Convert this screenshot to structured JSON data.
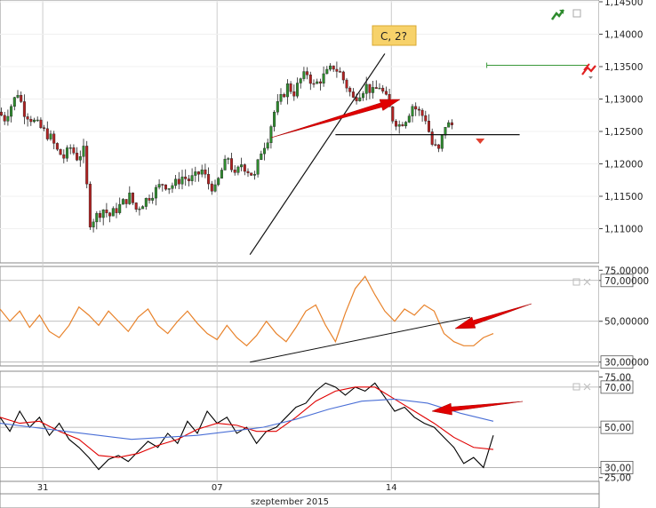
{
  "colors": {
    "up": "#2e8b2e",
    "down": "#b22222",
    "rsi": "#e8822a",
    "stoch_k": "#000000",
    "stoch_d": "#e00000",
    "stoch_slow": "#4a6fd6",
    "arrow": "#e00000",
    "grid": "#cccccc",
    "annotation_bg": "#f7d26a"
  },
  "annotation": {
    "label": "C, 2?"
  },
  "x_axis": {
    "ticks": [
      {
        "label": "31",
        "index": 13
      },
      {
        "label": "07",
        "index": 66
      },
      {
        "label": "14",
        "index": 119
      }
    ],
    "month_label": "szeptember 2015",
    "n_bars": 138
  },
  "chart_data": [
    {
      "type": "candlestick",
      "panel": "price",
      "ylim": [
        1.105,
        1.145
      ],
      "y_ticks": [
        "1,14500",
        "1,14000",
        "1,13500",
        "1,13000",
        "1,12500",
        "1,12000",
        "1,11500",
        "1,11000"
      ],
      "y_tick_values": [
        1.145,
        1.14,
        1.135,
        1.13,
        1.125,
        1.12,
        1.115,
        1.11
      ],
      "close_path": [
        [
          0,
          1.128
        ],
        [
          2,
          1.127
        ],
        [
          4,
          1.129
        ],
        [
          6,
          1.131
        ],
        [
          8,
          1.128
        ],
        [
          10,
          1.127
        ],
        [
          12,
          1.126
        ],
        [
          14,
          1.125
        ],
        [
          16,
          1.124
        ],
        [
          18,
          1.122
        ],
        [
          20,
          1.121
        ],
        [
          22,
          1.1225
        ],
        [
          24,
          1.121
        ],
        [
          26,
          1.122
        ],
        [
          28,
          1.111
        ],
        [
          30,
          1.112
        ],
        [
          32,
          1.113
        ],
        [
          34,
          1.112
        ],
        [
          36,
          1.113
        ],
        [
          38,
          1.114
        ],
        [
          40,
          1.115
        ],
        [
          42,
          1.113
        ],
        [
          44,
          1.114
        ],
        [
          46,
          1.115
        ],
        [
          48,
          1.116
        ],
        [
          50,
          1.117
        ],
        [
          52,
          1.1165
        ],
        [
          54,
          1.117
        ],
        [
          56,
          1.118
        ],
        [
          58,
          1.1175
        ],
        [
          60,
          1.118
        ],
        [
          62,
          1.119
        ],
        [
          64,
          1.117
        ],
        [
          66,
          1.116
        ],
        [
          68,
          1.119
        ],
        [
          70,
          1.121
        ],
        [
          72,
          1.118
        ],
        [
          74,
          1.12
        ],
        [
          76,
          1.119
        ],
        [
          78,
          1.118
        ],
        [
          80,
          1.122
        ],
        [
          82,
          1.124
        ],
        [
          84,
          1.128
        ],
        [
          86,
          1.13
        ],
        [
          88,
          1.132
        ],
        [
          90,
          1.131
        ],
        [
          92,
          1.133
        ],
        [
          94,
          1.134
        ],
        [
          96,
          1.132
        ],
        [
          98,
          1.133
        ],
        [
          100,
          1.134
        ],
        [
          102,
          1.135
        ],
        [
          104,
          1.134
        ],
        [
          106,
          1.132
        ],
        [
          108,
          1.13
        ],
        [
          110,
          1.131
        ],
        [
          112,
          1.132
        ],
        [
          114,
          1.131
        ],
        [
          116,
          1.132
        ],
        [
          118,
          1.13
        ],
        [
          120,
          1.127
        ],
        [
          122,
          1.126
        ],
        [
          124,
          1.127
        ],
        [
          126,
          1.129
        ],
        [
          128,
          1.128
        ],
        [
          130,
          1.127
        ],
        [
          132,
          1.123
        ],
        [
          134,
          1.122
        ],
        [
          136,
          1.126
        ]
      ],
      "trendlines": [
        {
          "from": [
            76,
            1.106
          ],
          "to": [
            117,
            1.137
          ]
        },
        {
          "from": [
            102,
            1.1245
          ],
          "to": [
            158,
            1.1245
          ]
        }
      ],
      "alert_line": {
        "from": [
          148,
          1.1352
        ],
        "to": [
          179,
          1.1352
        ]
      },
      "marker": {
        "index": 146,
        "value": 1.1235
      }
    },
    {
      "type": "line",
      "panel": "rsi",
      "ylim": [
        29,
        76
      ],
      "y_ticks": [
        "75,00000",
        "70,00000",
        "50,00000",
        "30,00000"
      ],
      "y_tick_values": [
        75,
        70,
        50,
        30
      ],
      "y_tick_boxed": [
        false,
        true,
        false,
        true
      ],
      "hlines": [
        70,
        50,
        30
      ],
      "path": [
        [
          0,
          56
        ],
        [
          3,
          50
        ],
        [
          6,
          55
        ],
        [
          9,
          47
        ],
        [
          12,
          53
        ],
        [
          15,
          45
        ],
        [
          18,
          42
        ],
        [
          21,
          48
        ],
        [
          24,
          57
        ],
        [
          27,
          53
        ],
        [
          30,
          48
        ],
        [
          33,
          55
        ],
        [
          36,
          50
        ],
        [
          39,
          45
        ],
        [
          42,
          52
        ],
        [
          45,
          56
        ],
        [
          48,
          48
        ],
        [
          51,
          44
        ],
        [
          54,
          50
        ],
        [
          57,
          55
        ],
        [
          60,
          49
        ],
        [
          63,
          44
        ],
        [
          66,
          41
        ],
        [
          69,
          48
        ],
        [
          72,
          42
        ],
        [
          75,
          38
        ],
        [
          78,
          43
        ],
        [
          81,
          50
        ],
        [
          84,
          44
        ],
        [
          87,
          40
        ],
        [
          90,
          47
        ],
        [
          93,
          55
        ],
        [
          96,
          58
        ],
        [
          99,
          48
        ],
        [
          102,
          40
        ],
        [
          105,
          54
        ],
        [
          108,
          66
        ],
        [
          111,
          72
        ],
        [
          114,
          63
        ],
        [
          117,
          55
        ],
        [
          120,
          50
        ],
        [
          123,
          56
        ],
        [
          126,
          53
        ],
        [
          129,
          58
        ],
        [
          132,
          55
        ],
        [
          135,
          44
        ],
        [
          138,
          40
        ],
        [
          141,
          38
        ],
        [
          144,
          38
        ],
        [
          147,
          42
        ],
        [
          150,
          44
        ]
      ],
      "trendlines": [
        {
          "from": [
            76,
            30
          ],
          "to": [
            143,
            52
          ]
        }
      ]
    },
    {
      "type": "line",
      "panel": "stochastic",
      "ylim": [
        24,
        77
      ],
      "y_ticks": [
        "75,00",
        "70,00",
        "50,00",
        "30,00",
        "25,00"
      ],
      "y_tick_values": [
        75,
        70,
        50,
        30,
        25
      ],
      "y_tick_boxed": [
        false,
        true,
        true,
        true,
        false
      ],
      "hlines": [
        70,
        50,
        30
      ],
      "series": [
        {
          "name": "k",
          "path": [
            [
              0,
              55
            ],
            [
              3,
              48
            ],
            [
              6,
              58
            ],
            [
              9,
              50
            ],
            [
              12,
              55
            ],
            [
              15,
              46
            ],
            [
              18,
              52
            ],
            [
              21,
              44
            ],
            [
              24,
              40
            ],
            [
              27,
              35
            ],
            [
              30,
              29
            ],
            [
              33,
              34
            ],
            [
              36,
              36
            ],
            [
              39,
              33
            ],
            [
              42,
              38
            ],
            [
              45,
              43
            ],
            [
              48,
              40
            ],
            [
              51,
              47
            ],
            [
              54,
              42
            ],
            [
              57,
              53
            ],
            [
              60,
              47
            ],
            [
              63,
              58
            ],
            [
              66,
              52
            ],
            [
              69,
              55
            ],
            [
              72,
              47
            ],
            [
              75,
              50
            ],
            [
              78,
              42
            ],
            [
              81,
              48
            ],
            [
              84,
              50
            ],
            [
              87,
              55
            ],
            [
              90,
              60
            ],
            [
              93,
              62
            ],
            [
              96,
              68
            ],
            [
              99,
              72
            ],
            [
              102,
              70
            ],
            [
              105,
              66
            ],
            [
              108,
              70
            ],
            [
              111,
              68
            ],
            [
              114,
              72
            ],
            [
              117,
              65
            ],
            [
              120,
              58
            ],
            [
              123,
              60
            ],
            [
              126,
              55
            ],
            [
              129,
              52
            ],
            [
              132,
              50
            ],
            [
              135,
              45
            ],
            [
              138,
              40
            ],
            [
              141,
              32
            ],
            [
              144,
              35
            ],
            [
              147,
              30
            ],
            [
              150,
              46
            ]
          ]
        },
        {
          "name": "d",
          "path": [
            [
              0,
              55
            ],
            [
              6,
              52
            ],
            [
              12,
              53
            ],
            [
              18,
              48
            ],
            [
              24,
              44
            ],
            [
              30,
              36
            ],
            [
              36,
              35
            ],
            [
              42,
              37
            ],
            [
              48,
              41
            ],
            [
              54,
              44
            ],
            [
              60,
              49
            ],
            [
              66,
              52
            ],
            [
              72,
              51
            ],
            [
              78,
              48
            ],
            [
              84,
              48
            ],
            [
              90,
              55
            ],
            [
              96,
              63
            ],
            [
              102,
              68
            ],
            [
              108,
              70
            ],
            [
              114,
              70
            ],
            [
              120,
              64
            ],
            [
              126,
              58
            ],
            [
              132,
              52
            ],
            [
              138,
              45
            ],
            [
              144,
              40
            ],
            [
              150,
              39
            ]
          ]
        },
        {
          "name": "slow",
          "path": [
            [
              0,
              52
            ],
            [
              10,
              50
            ],
            [
              20,
              48
            ],
            [
              30,
              46
            ],
            [
              40,
              44
            ],
            [
              50,
              45
            ],
            [
              60,
              46
            ],
            [
              70,
              48
            ],
            [
              80,
              50
            ],
            [
              90,
              54
            ],
            [
              100,
              59
            ],
            [
              110,
              63
            ],
            [
              120,
              64
            ],
            [
              130,
              62
            ],
            [
              140,
              57
            ],
            [
              150,
              53
            ]
          ]
        }
      ]
    }
  ]
}
